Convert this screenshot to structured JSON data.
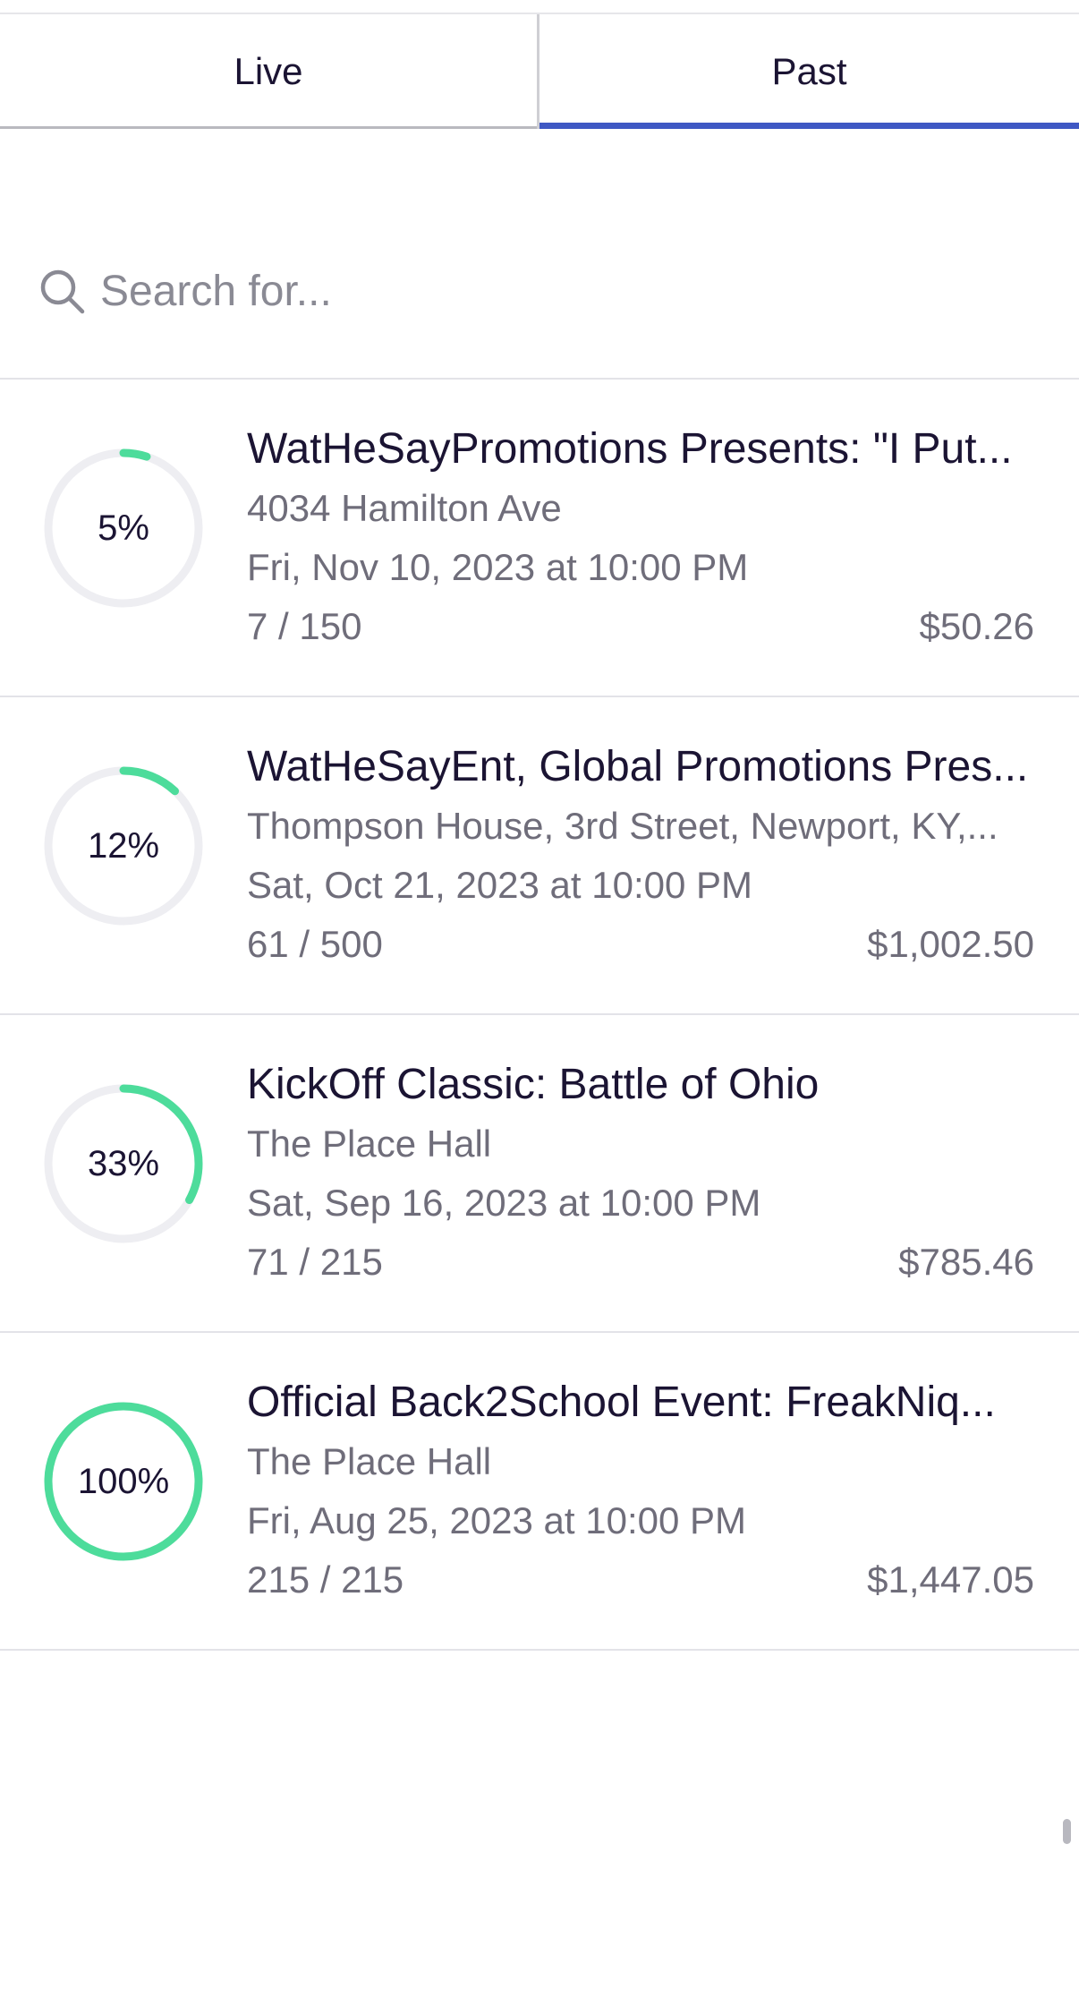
{
  "tabs": [
    {
      "label": "Live",
      "active": false
    },
    {
      "label": "Past",
      "active": true
    }
  ],
  "search": {
    "placeholder": "Search for...",
    "value": ""
  },
  "colors": {
    "accent": "#3f58c4",
    "progress": "#4ddc9b",
    "track": "#eeeef2",
    "text_primary": "#1b1433",
    "text_secondary": "#6f6d7a"
  },
  "events": [
    {
      "title": "WatHeSayPromotions Presents:  \"I Put...",
      "venue": "4034 Hamilton Ave",
      "date": "Fri, Nov 10, 2023 at 10:00 PM",
      "sold": "7 / 150",
      "revenue": "$50.26",
      "percent_label": "5%",
      "progress": 0.05
    },
    {
      "title": "WatHeSayEnt, Global Promotions Pres...",
      "venue": "Thompson House, 3rd Street, Newport, KY,...",
      "date": "Sat, Oct 21, 2023 at 10:00 PM",
      "sold": "61 / 500",
      "revenue": "$1,002.50",
      "percent_label": "12%",
      "progress": 0.12
    },
    {
      "title": "KickOff Classic: Battle of Ohio",
      "venue": "The Place Hall",
      "date": "Sat, Sep 16, 2023 at 10:00 PM",
      "sold": "71 / 215",
      "revenue": "$785.46",
      "percent_label": "33%",
      "progress": 0.33
    },
    {
      "title": "Official Back2School Event: FreakNiq...",
      "venue": "The Place Hall",
      "date": "Fri, Aug 25, 2023 at 10:00 PM",
      "sold": "215 / 215",
      "revenue": "$1,447.05",
      "percent_label": "100%",
      "progress": 1.0
    }
  ]
}
